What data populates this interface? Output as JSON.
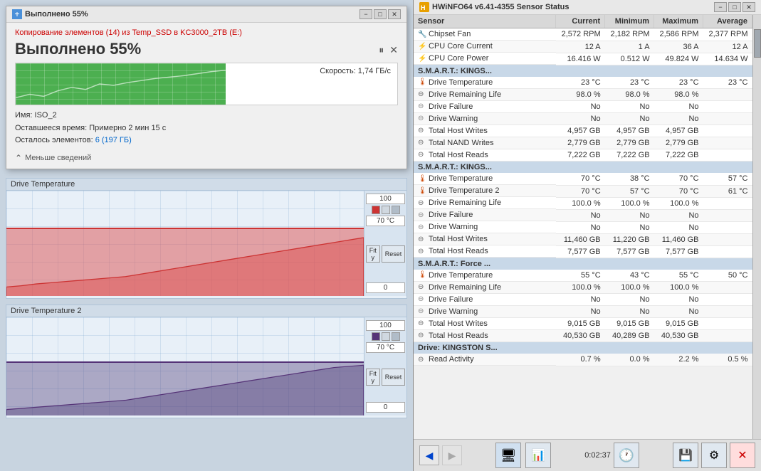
{
  "leftPanel": {
    "copyDialog": {
      "title": "Выполнено 55%",
      "infoText": "Копирование элементов (14) из Temp_SSD в KC3000_2TB (E:)",
      "progressLabel": "Выполнено 55%",
      "progressPercent": 55,
      "speed": "Скорость: 1,74 ГБ/с",
      "name": "Имя: ISO_2",
      "timeRemaining": "Оставшееся время: Примерно 2 мин 15 с",
      "itemsLeft": "Осталось элементов: 6 (197 ГБ)",
      "lessInfo": "Меньше сведений",
      "btnMinimize": "−",
      "btnMaximize": "□",
      "btnClose": "✕",
      "btnPause": "⏸",
      "btnStop": "✕"
    },
    "chart1": {
      "title": "Drive Temperature",
      "maxValue": "100",
      "currentValue": "70 °C",
      "minValue": "0",
      "fillHeight": "65%",
      "btnFit": "Fit y",
      "btnReset": "Reset"
    },
    "chart2": {
      "title": "Drive Temperature 2",
      "maxValue": "100",
      "currentValue": "70 °C",
      "minValue": "0",
      "fillHeight": "55%",
      "btnFit": "Fit y",
      "btnReset": "Reset"
    }
  },
  "rightPanel": {
    "title": "HWiNFO64 v6.41-4355 Sensor Status",
    "btnMinimize": "−",
    "btnMaximize": "□",
    "btnClose": "✕",
    "tableHeaders": {
      "sensor": "Sensor",
      "current": "Current",
      "minimum": "Minimum",
      "maximum": "Maximum",
      "average": "Average"
    },
    "sections": [
      {
        "type": "data",
        "rows": [
          {
            "name": "Chipset Fan",
            "icon": "fan",
            "current": "2,572 RPM",
            "minimum": "2,182 RPM",
            "maximum": "2,586 RPM",
            "average": "2,377 RPM"
          },
          {
            "name": "CPU Core Current",
            "icon": "cpu",
            "current": "12 A",
            "minimum": "1 A",
            "maximum": "36 A",
            "average": "12 A"
          },
          {
            "name": "CPU Core Power",
            "icon": "cpu",
            "current": "16.416 W",
            "minimum": "0.512 W",
            "maximum": "49.824 W",
            "average": "14.634 W"
          }
        ]
      },
      {
        "type": "group",
        "label": "S.M.A.R.T.: KINGS...",
        "rows": [
          {
            "name": "Drive Temperature",
            "icon": "temp",
            "current": "23 °C",
            "minimum": "23 °C",
            "maximum": "23 °C",
            "average": "23 °C"
          },
          {
            "name": "Drive Remaining Life",
            "icon": "life",
            "current": "98.0 %",
            "minimum": "98.0 %",
            "maximum": "98.0 %",
            "average": ""
          },
          {
            "name": "Drive Failure",
            "icon": "warn",
            "current": "No",
            "minimum": "No",
            "maximum": "No",
            "average": ""
          },
          {
            "name": "Drive Warning",
            "icon": "warn",
            "current": "No",
            "minimum": "No",
            "maximum": "No",
            "average": ""
          },
          {
            "name": "Total Host Writes",
            "icon": "write",
            "current": "4,957 GB",
            "minimum": "4,957 GB",
            "maximum": "4,957 GB",
            "average": ""
          },
          {
            "name": "Total NAND Writes",
            "icon": "write",
            "current": "2,779 GB",
            "minimum": "2,779 GB",
            "maximum": "2,779 GB",
            "average": ""
          },
          {
            "name": "Total Host Reads",
            "icon": "write",
            "current": "7,222 GB",
            "minimum": "7,222 GB",
            "maximum": "7,222 GB",
            "average": ""
          }
        ]
      },
      {
        "type": "group",
        "label": "S.M.A.R.T.: KINGS...",
        "rows": [
          {
            "name": "Drive Temperature",
            "icon": "temp",
            "current": "70 °C",
            "minimum": "38 °C",
            "maximum": "70 °C",
            "average": "57 °C"
          },
          {
            "name": "Drive Temperature 2",
            "icon": "temp",
            "current": "70 °C",
            "minimum": "57 °C",
            "maximum": "70 °C",
            "average": "61 °C"
          },
          {
            "name": "Drive Remaining Life",
            "icon": "life",
            "current": "100.0 %",
            "minimum": "100.0 %",
            "maximum": "100.0 %",
            "average": ""
          },
          {
            "name": "Drive Failure",
            "icon": "warn",
            "current": "No",
            "minimum": "No",
            "maximum": "No",
            "average": ""
          },
          {
            "name": "Drive Warning",
            "icon": "warn",
            "current": "No",
            "minimum": "No",
            "maximum": "No",
            "average": ""
          },
          {
            "name": "Total Host Writes",
            "icon": "write",
            "current": "11,460 GB",
            "minimum": "11,220 GB",
            "maximum": "11,460 GB",
            "average": ""
          },
          {
            "name": "Total Host Reads",
            "icon": "write",
            "current": "7,577 GB",
            "minimum": "7,577 GB",
            "maximum": "7,577 GB",
            "average": ""
          }
        ]
      },
      {
        "type": "group",
        "label": "S.M.A.R.T.: Force ...",
        "rows": [
          {
            "name": "Drive Temperature",
            "icon": "temp",
            "current": "55 °C",
            "minimum": "43 °C",
            "maximum": "55 °C",
            "average": "50 °C"
          },
          {
            "name": "Drive Remaining Life",
            "icon": "life",
            "current": "100.0 %",
            "minimum": "100.0 %",
            "maximum": "100.0 %",
            "average": ""
          },
          {
            "name": "Drive Failure",
            "icon": "warn",
            "current": "No",
            "minimum": "No",
            "maximum": "No",
            "average": ""
          },
          {
            "name": "Drive Warning",
            "icon": "warn",
            "current": "No",
            "minimum": "No",
            "maximum": "No",
            "average": ""
          },
          {
            "name": "Total Host Writes",
            "icon": "write",
            "current": "9,015 GB",
            "minimum": "9,015 GB",
            "maximum": "9,015 GB",
            "average": ""
          },
          {
            "name": "Total Host Reads",
            "icon": "write",
            "current": "40,530 GB",
            "minimum": "40,289 GB",
            "maximum": "40,530 GB",
            "average": ""
          }
        ]
      },
      {
        "type": "group",
        "label": "Drive: KINGSTON S...",
        "rows": [
          {
            "name": "Read Activity",
            "icon": "write",
            "current": "0.7 %",
            "minimum": "0.0 %",
            "maximum": "2.2 %",
            "average": "0.5 %"
          }
        ]
      }
    ],
    "toolbar": {
      "backBtn": "◀",
      "forwardBtn": "▶",
      "time": "0:02:37",
      "icons": [
        "🖥",
        "📊",
        "🔧",
        "⚙",
        "✕"
      ]
    }
  }
}
